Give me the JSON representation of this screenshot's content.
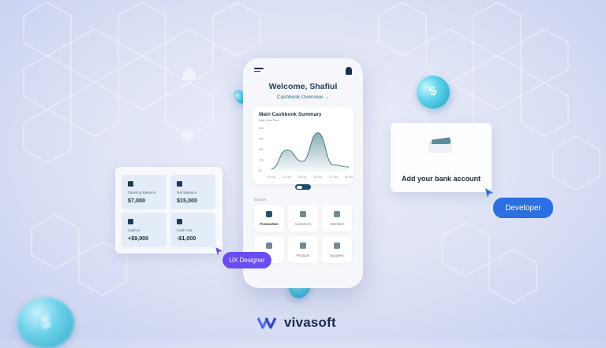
{
  "phone": {
    "greeting": "Welcome, Shafiul",
    "overview_link": "Cashbook Overview →",
    "chart_title": "Main Cashbook Summary",
    "chart_subtitle": "Daily Cash Flow",
    "explore_label": "Explore",
    "tiles": [
      {
        "label": "Transaction",
        "icon": "transaction-icon"
      },
      {
        "label": "Customers",
        "icon": "customers-icon"
      },
      {
        "label": "Members",
        "icon": "members-icon"
      },
      {
        "label": "",
        "icon": "clipboard-icon"
      },
      {
        "label": "Products",
        "icon": "products-icon"
      },
      {
        "label": "Suppliers",
        "icon": "suppliers-icon"
      }
    ]
  },
  "chart_data": {
    "type": "area",
    "categories": [
      "20 Oct",
      "21 Oct",
      "25 Oct",
      "26 Oct",
      "27 Oct",
      "28 Oct"
    ],
    "values": [
      0.25,
      1.9,
      0.9,
      3.4,
      0.6,
      0.4
    ],
    "yticks": [
      "25k",
      "20k",
      "15k",
      "10k",
      "5k"
    ],
    "color": "#2a6b7a"
  },
  "balances": [
    {
      "label": "Opening Balance",
      "value": "$7,000"
    },
    {
      "label": "Net Balance",
      "value": "$15,000"
    },
    {
      "label": "Cash In",
      "value": "+$9,000"
    },
    {
      "label": "Cash Out",
      "value": "-$1,000"
    }
  ],
  "bank_card": {
    "text": "Add your bank account"
  },
  "badges": {
    "developer": "Developer",
    "ux": "UX Designer"
  },
  "brand": {
    "name": "vivasoft",
    "accent": "#3b5bdb"
  }
}
